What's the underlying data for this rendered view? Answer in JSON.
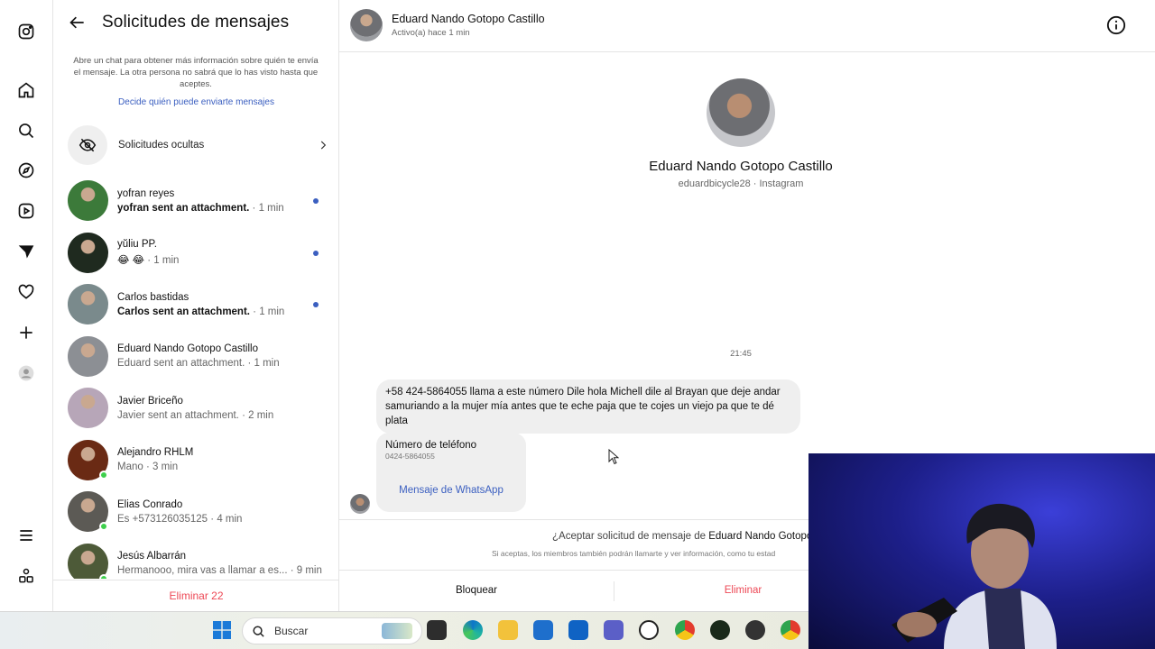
{
  "sidebar": {
    "icons": [
      "instagram-icon",
      "home-icon",
      "search-icon",
      "explore-icon",
      "reels-icon",
      "messages-icon",
      "notifications-icon",
      "create-icon",
      "profile-icon",
      "menu-icon",
      "more-apps-icon"
    ]
  },
  "requests": {
    "title": "Solicitudes de mensajes",
    "info": "Abre un chat para obtener más información sobre quién te envía el mensaje. La otra persona no sabrá que lo has visto hasta que aceptes.",
    "decide_link": "Decide quién puede enviarte mensajes",
    "hidden_label": "Solicitudes ocultas",
    "delete_all": "Eliminar 22",
    "items": [
      {
        "name": "yofran reyes",
        "preview": "yofran sent an attachment.",
        "time": " · 1 min",
        "unread": true,
        "online": false,
        "color": "#3c7a3a"
      },
      {
        "name": "yŭliu PP.",
        "preview": "😂 😂",
        "time": " · 1 min",
        "unread": true,
        "online": false,
        "color": "#1f2a1f"
      },
      {
        "name": "Carlos bastidas",
        "preview": "Carlos sent an attachment.",
        "time": " · 1 min",
        "unread": true,
        "online": false,
        "color": "#7a8a8c"
      },
      {
        "name": "Eduard Nando Gotopo Castillo",
        "preview": "Eduard sent an attachment.",
        "time": " · 1 min",
        "unread": false,
        "online": false,
        "color": "#8c8f94"
      },
      {
        "name": "Javier Briceño",
        "preview": "Javier sent an attachment.",
        "time": " · 2 min",
        "unread": false,
        "online": false,
        "color": "#b7a6b8"
      },
      {
        "name": "Alejandro RHLM",
        "preview": "Mano",
        "time": " · 3 min",
        "unread": false,
        "online": true,
        "color": "#6a2a14"
      },
      {
        "name": "Elias Conrado",
        "preview": "Es +573126035125",
        "time": " · 4 min",
        "unread": false,
        "online": true,
        "color": "#5c5a55"
      },
      {
        "name": "Jesús Albarrán",
        "preview": "Hermanooo, mira vas a llamar a es...",
        "time": " · 9 min",
        "unread": false,
        "online": true,
        "color": "#4d5a38"
      }
    ]
  },
  "chat": {
    "header_name": "Eduard Nando Gotopo Castillo",
    "header_status": "Activo(a) hace 1 min",
    "profile_name": "Eduard Nando Gotopo Castillo",
    "profile_handle": "eduardbicycle28 · Instagram",
    "timestamp": "21:45",
    "message": "+58 424-5864055 llama a este número Dile hola Michell dile al Brayan que deje andar samuriando a la mujer mía antes que te eche paja que te cojes un viejo pa que te dé plata",
    "phone_card_title": "Número de teléfono",
    "phone_card_number": "0424-5864055",
    "phone_card_link": "Mensaje de WhatsApp",
    "accept_question": "¿Aceptar solicitud de mensaje de ",
    "accept_name": "Eduard Nando Gotopo",
    "accept_note": "Si aceptas, los miembros también podrán llamarte y ver información, como tu estad",
    "block_label": "Bloquear",
    "delete_label": "Eliminar"
  },
  "taskbar": {
    "search_placeholder": "Buscar"
  },
  "colors": {
    "accent_blue": "#3b5fc0",
    "danger_red": "#ed4956",
    "online_green": "#3ecf4c"
  }
}
